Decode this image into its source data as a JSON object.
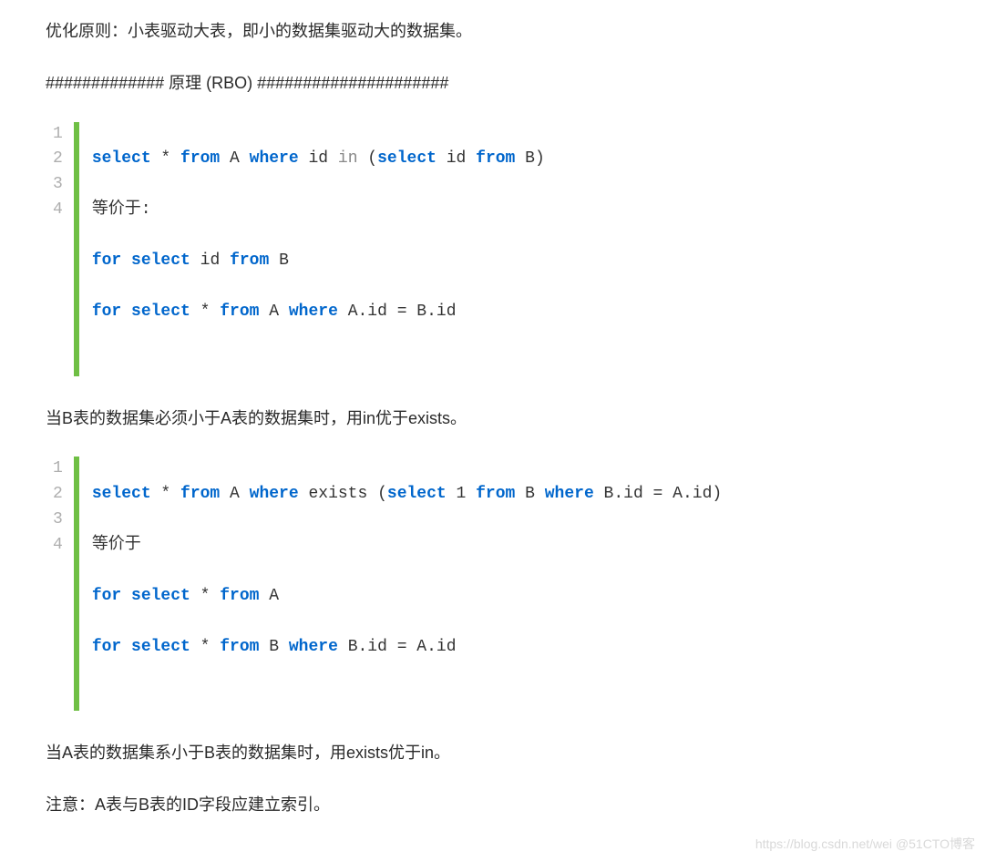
{
  "text": {
    "p1": "优化原则：小表驱动大表，即小的数据集驱动大的数据集。",
    "p2": "############# 原理 (RBO) #####################",
    "p3": "当B表的数据集必须小于A表的数据集时，用in优于exists。",
    "p4": "当A表的数据集系小于B表的数据集时，用exists优于in。",
    "p5": "注意：A表与B表的ID字段应建立索引。"
  },
  "code1": {
    "nums": [
      "1",
      "2",
      "3",
      "4"
    ],
    "l1": {
      "a": "select",
      "b": " * ",
      "c": "from",
      "d": " A ",
      "e": "where",
      "f": " id ",
      "g": "in",
      "h": " (",
      "i": "select",
      "j": " id ",
      "k": "from",
      "l": " B)"
    },
    "l2": "等价于:",
    "l3": {
      "a": "for",
      "b": " ",
      "c": "select",
      "d": " id ",
      "e": "from",
      "f": " B"
    },
    "l4": {
      "a": "for",
      "b": " ",
      "c": "select",
      "d": " * ",
      "e": "from",
      "f": " A ",
      "g": "where",
      "h": " A.id = B.id"
    }
  },
  "code2": {
    "nums": [
      "1",
      "2",
      "3",
      "4"
    ],
    "l1": {
      "a": "select",
      "b": " * ",
      "c": "from",
      "d": " A ",
      "e": "where",
      "f": " exists (",
      "g": "select",
      "h": " 1 ",
      "i": "from",
      "j": " B ",
      "k": "where",
      "l": " B.id = A.id)"
    },
    "l2": "等价于",
    "l3": {
      "a": "for",
      "b": " ",
      "c": "select",
      "d": " * ",
      "e": "from",
      "f": " A"
    },
    "l4": {
      "a": "for",
      "b": " ",
      "c": "select",
      "d": " * ",
      "e": "from",
      "f": " B ",
      "g": "where",
      "h": " B.id = A.id"
    }
  },
  "watermark": "https://blog.csdn.net/wei @51CTO博客"
}
